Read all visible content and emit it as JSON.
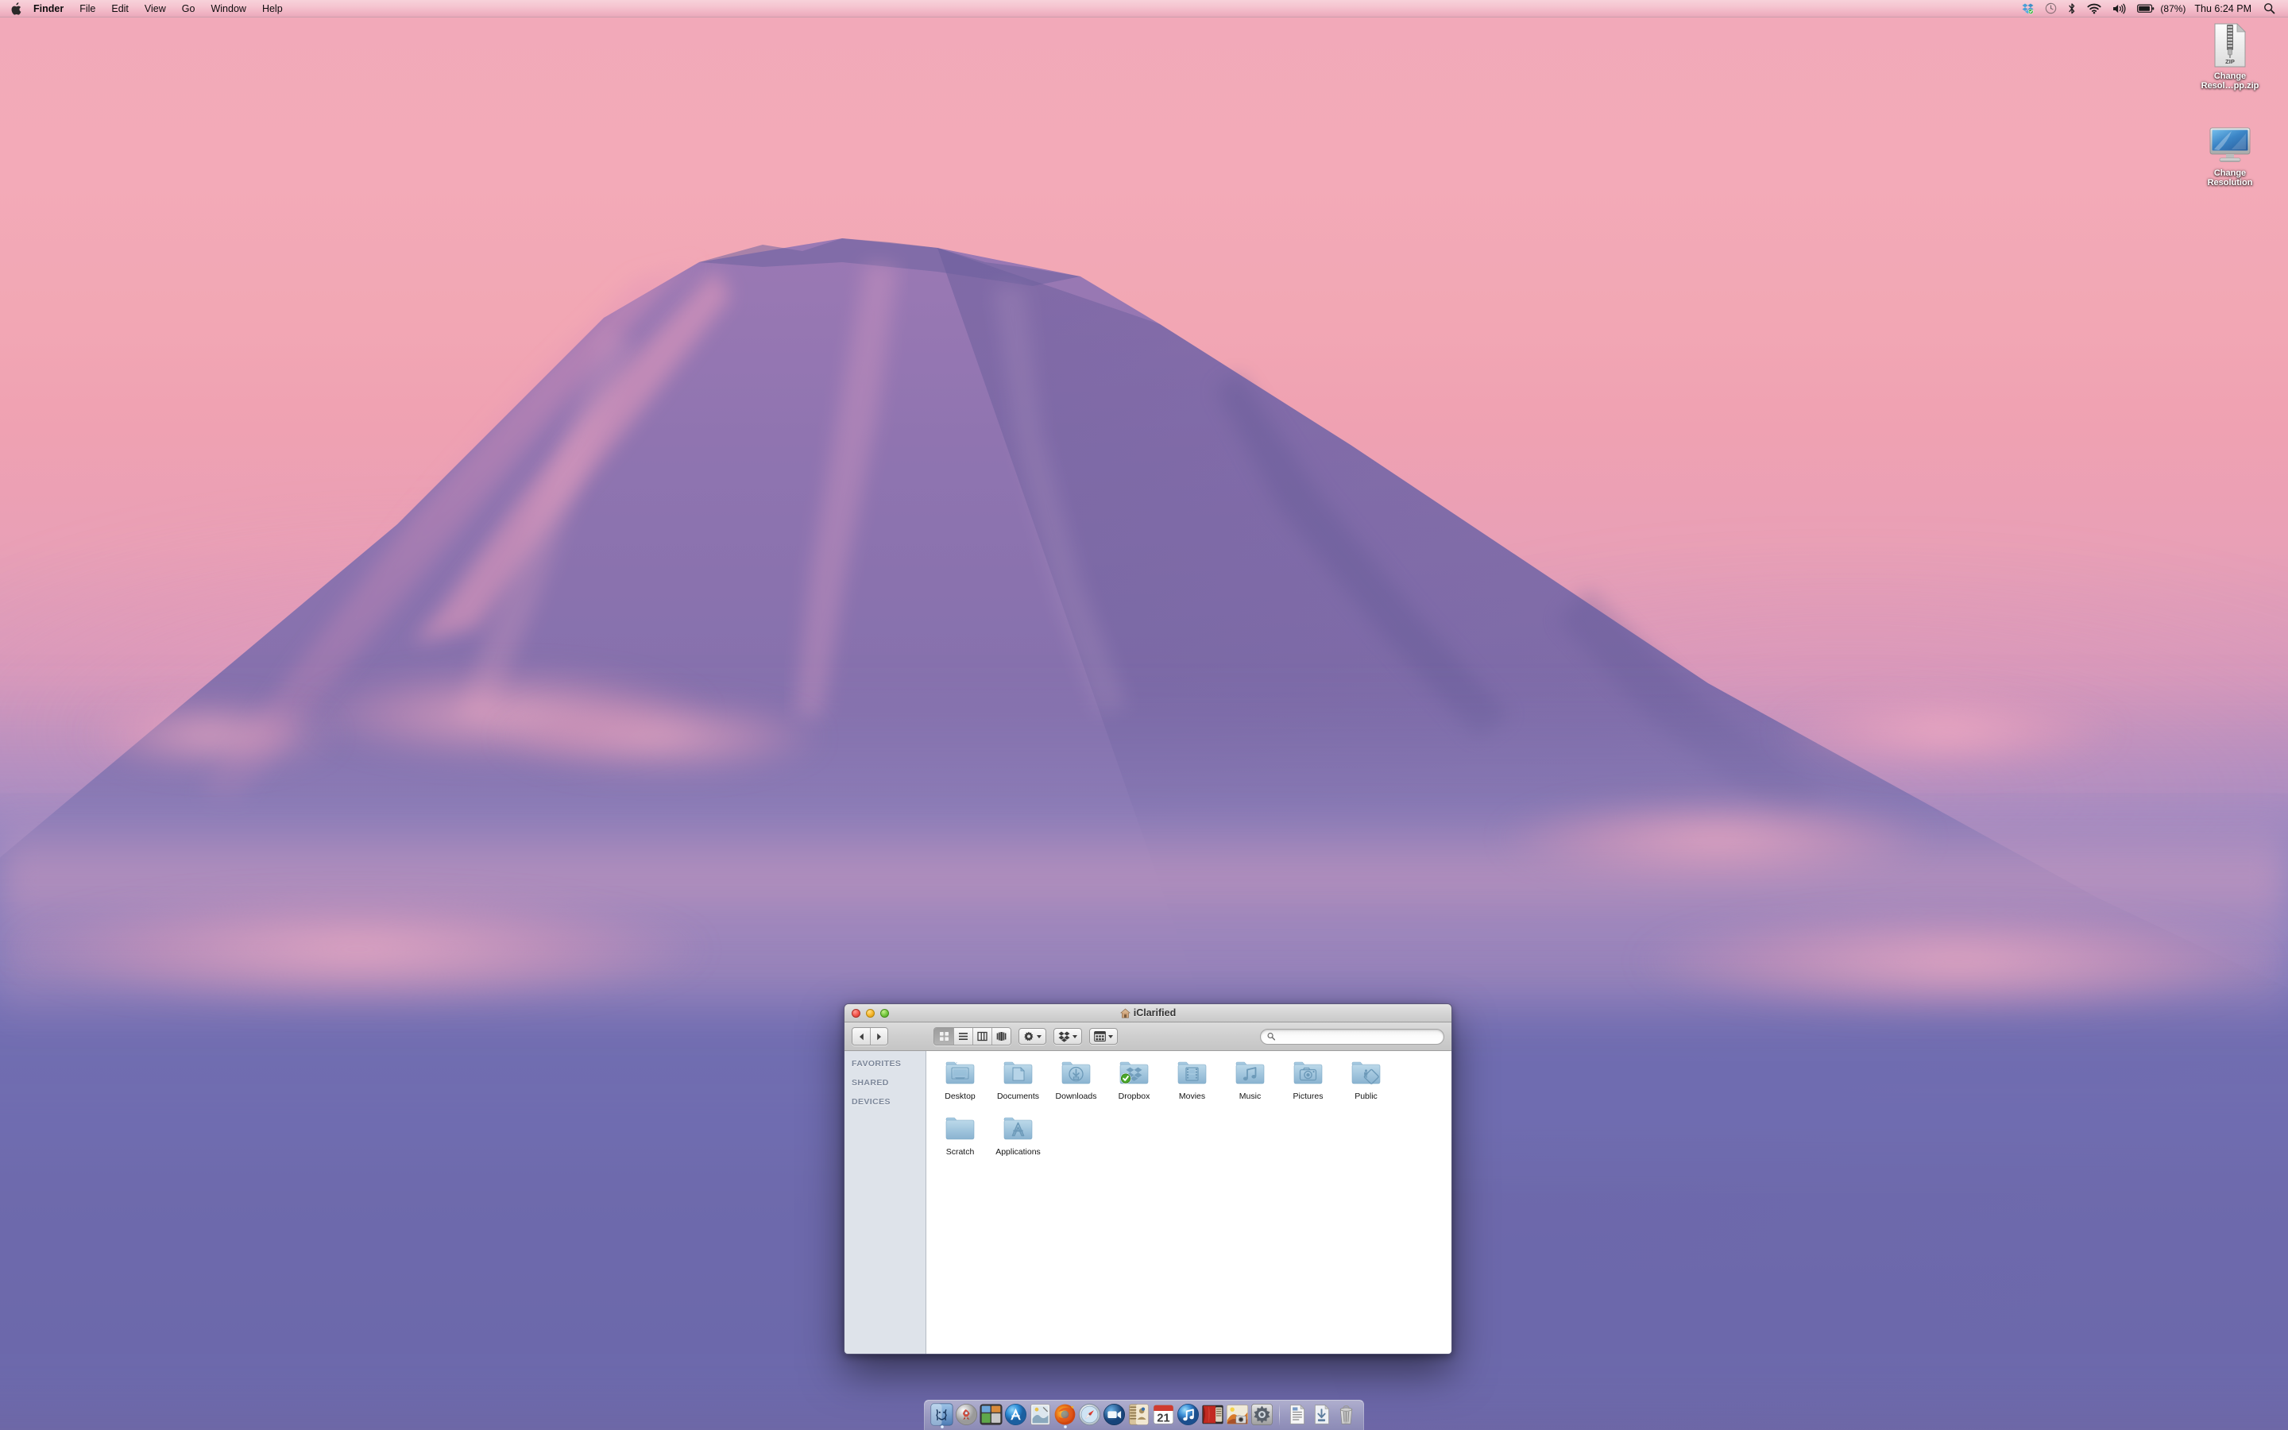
{
  "menubar": {
    "apple_icon": "apple-logo-icon",
    "items": [
      {
        "label": "Finder",
        "bold": true
      },
      {
        "label": "File",
        "bold": false
      },
      {
        "label": "Edit",
        "bold": false
      },
      {
        "label": "View",
        "bold": false
      },
      {
        "label": "Go",
        "bold": false
      },
      {
        "label": "Window",
        "bold": false
      },
      {
        "label": "Help",
        "bold": false
      }
    ],
    "status_icons": [
      "dropbox-icon",
      "time-machine-icon",
      "bluetooth-icon",
      "wifi-icon",
      "volume-icon",
      "battery-icon"
    ],
    "battery_percent": "(87%)",
    "clock": "Thu 6:24 PM",
    "spotlight_icon": "search-icon"
  },
  "desktop": {
    "icons": [
      {
        "name": "Change\nResol…pp.zip",
        "line1": "Change",
        "line2": "Resol…pp.zip",
        "type": "zip-archive-icon",
        "zip_label": "ZIP"
      },
      {
        "name": "Change Resolution",
        "line1": "Change",
        "line2": "Resolution",
        "type": "display-app-icon"
      }
    ]
  },
  "finder": {
    "title": "iClarified",
    "title_icon": "home-icon",
    "window_controls": [
      "close-button",
      "minimize-button",
      "zoom-button"
    ],
    "toolbar": {
      "back_label": "Back",
      "forward_label": "Forward",
      "views": [
        {
          "name": "icon-view",
          "active": true
        },
        {
          "name": "list-view",
          "active": false
        },
        {
          "name": "column-view",
          "active": false
        },
        {
          "name": "coverflow-view",
          "active": false
        }
      ],
      "action_menu": "gear-icon",
      "dropbox_menu": "dropbox-icon",
      "arrange_menu": "arrange-icon",
      "search_placeholder": "",
      "search_value": ""
    },
    "sidebar": {
      "sections": [
        "FAVORITES",
        "SHARED",
        "DEVICES"
      ]
    },
    "items": [
      {
        "label": "Desktop",
        "icon": "desktop-folder-icon",
        "badge": null
      },
      {
        "label": "Documents",
        "icon": "documents-folder-icon",
        "badge": null
      },
      {
        "label": "Downloads",
        "icon": "downloads-folder-icon",
        "badge": null
      },
      {
        "label": "Dropbox",
        "icon": "dropbox-folder-icon",
        "badge": "green-check-badge"
      },
      {
        "label": "Movies",
        "icon": "movies-folder-icon",
        "badge": null
      },
      {
        "label": "Music",
        "icon": "music-folder-icon",
        "badge": null
      },
      {
        "label": "Pictures",
        "icon": "pictures-folder-icon",
        "badge": null
      },
      {
        "label": "Public",
        "icon": "public-folder-icon",
        "badge": null
      },
      {
        "label": "Scratch",
        "icon": "plain-folder-icon",
        "badge": null
      },
      {
        "label": "Applications",
        "icon": "applications-folder-icon",
        "badge": null
      }
    ]
  },
  "dock": {
    "items": [
      {
        "label": "Finder",
        "icon": "finder-icon",
        "running": true
      },
      {
        "label": "Launchpad",
        "icon": "launchpad-icon",
        "running": false
      },
      {
        "label": "Mission Control",
        "icon": "mission-control-icon",
        "running": false
      },
      {
        "label": "App Store",
        "icon": "app-store-icon",
        "running": false
      },
      {
        "label": "Preview",
        "icon": "preview-icon",
        "running": false
      },
      {
        "label": "Firefox",
        "icon": "firefox-icon",
        "running": true
      },
      {
        "label": "Safari",
        "icon": "safari-icon",
        "running": false
      },
      {
        "label": "FaceTime",
        "icon": "facetime-icon",
        "running": false
      },
      {
        "label": "Contacts",
        "icon": "contacts-icon",
        "running": false
      },
      {
        "label": "Calendar",
        "icon": "calendar-icon",
        "running": false,
        "day": "21"
      },
      {
        "label": "iTunes",
        "icon": "itunes-icon",
        "running": false
      },
      {
        "label": "iDVD",
        "icon": "idvd-icon",
        "running": false
      },
      {
        "label": "iPhoto",
        "icon": "iphoto-icon",
        "running": false
      },
      {
        "label": "System Preferences",
        "icon": "system-preferences-icon",
        "running": false
      }
    ],
    "stacks": [
      {
        "label": "Documents",
        "icon": "documents-stack-icon"
      },
      {
        "label": "Downloads",
        "icon": "downloads-stack-icon"
      },
      {
        "label": "Trash",
        "icon": "trash-icon"
      }
    ]
  },
  "colors": {
    "sky_top": "#f2a9b9",
    "sky_bottom": "#54579e",
    "menubar": "#f3c2cf",
    "finder_sidebar": "#dee3ea",
    "finder_content": "#ffffff",
    "dropbox_badge_green": "#4aa82a",
    "folder_blue": "#93bcd8"
  }
}
